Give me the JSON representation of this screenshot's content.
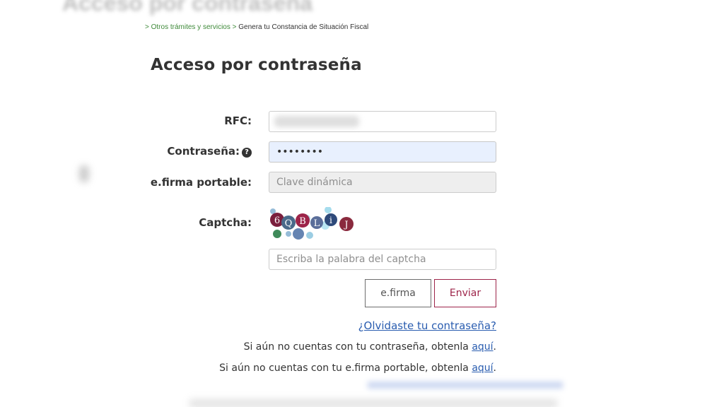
{
  "header": {
    "blurred_title": "Acceso por contraseña"
  },
  "breadcrumb": {
    "link": "> Otros trámites y servicios",
    "separator": " > ",
    "current": "Genera tu Constancia de Situación Fiscal"
  },
  "page_title": "Acceso por contraseña",
  "form": {
    "rfc_label": "RFC:",
    "password_label": "Contraseña:",
    "password_value": "••••••••",
    "efirma_label": "e.firma portable:",
    "efirma_placeholder": "Clave dinámica",
    "captcha_label": "Captcha:",
    "captcha_text": "6QBLiJ",
    "captcha_placeholder": "Escriba la palabra del captcha",
    "help_icon": "question-circle-icon"
  },
  "buttons": {
    "efirma": "e.firma",
    "enviar": "Enviar"
  },
  "links": {
    "forgot": "¿Olvidaste tu contraseña?",
    "line1_text": "Si aún no cuentas con tu contraseña, obtenla ",
    "line1_link": "aquí",
    "line2_text": "Si aún no cuentas con tu e.firma portable, obtenla ",
    "line2_link": "aquí",
    "period": "."
  },
  "colors": {
    "accent": "#9d2449",
    "link": "#2a5db0",
    "breadcrumb_link": "#3f8a3a",
    "autofill": "#e8f0fe"
  }
}
